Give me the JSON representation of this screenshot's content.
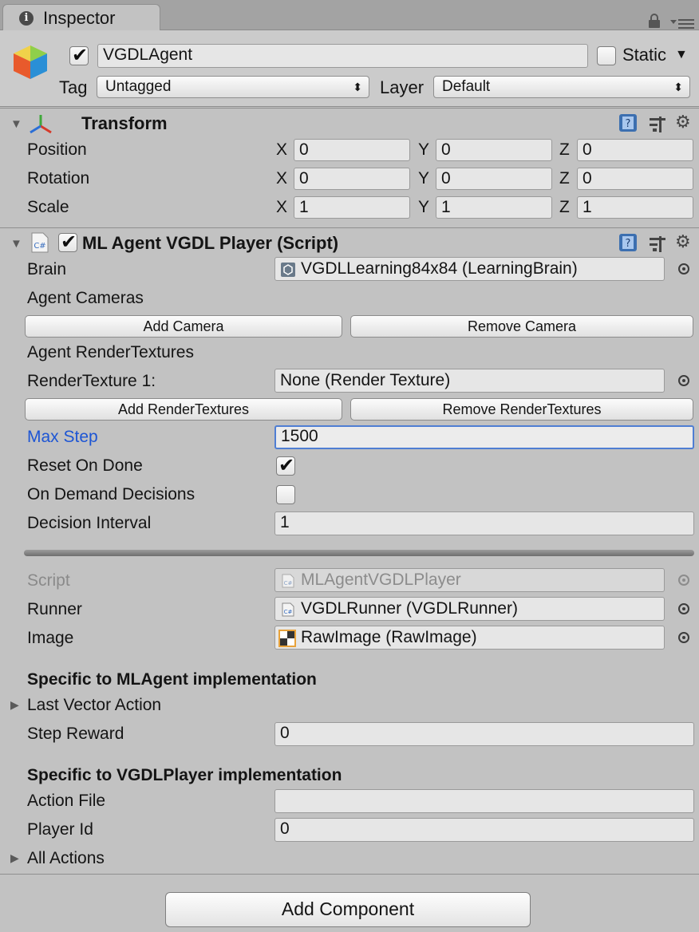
{
  "tab": {
    "title": "Inspector"
  },
  "header": {
    "object_name": "VGDLAgent",
    "static_label": "Static",
    "tag_label": "Tag",
    "tag_value": "Untagged",
    "layer_label": "Layer",
    "layer_value": "Default"
  },
  "transform": {
    "title": "Transform",
    "rows": [
      {
        "label": "Position",
        "x": "0",
        "y": "0",
        "z": "0"
      },
      {
        "label": "Rotation",
        "x": "0",
        "y": "0",
        "z": "0"
      },
      {
        "label": "Scale",
        "x": "1",
        "y": "1",
        "z": "1"
      }
    ],
    "axis": {
      "x": "X",
      "y": "Y",
      "z": "Z"
    }
  },
  "script": {
    "title": "ML Agent VGDL Player (Script)",
    "brain_label": "Brain",
    "brain_value": "VGDLLearning84x84 (LearningBrain)",
    "agent_cameras_label": "Agent Cameras",
    "add_camera": "Add Camera",
    "remove_camera": "Remove Camera",
    "agent_rendertextures_label": "Agent RenderTextures",
    "rendertexture1_label": "RenderTexture 1:",
    "rendertexture1_value": "None (Render Texture)",
    "add_rendertextures": "Add RenderTextures",
    "remove_rendertextures": "Remove RenderTextures",
    "max_step_label": "Max Step",
    "max_step_value": "1500",
    "reset_on_done_label": "Reset On Done",
    "on_demand_label": "On Demand Decisions",
    "decision_interval_label": "Decision Interval",
    "decision_interval_value": "1",
    "script_label": "Script",
    "script_value": "MLAgentVGDLPlayer",
    "runner_label": "Runner",
    "runner_value": "VGDLRunner (VGDLRunner)",
    "image_label": "Image",
    "image_value": "RawImage (RawImage)",
    "mlagent_section": "Specific to MLAgent implementation",
    "last_vector_action": "Last Vector Action",
    "step_reward_label": "Step Reward",
    "step_reward_value": "0",
    "vgdl_section": "Specific to VGDLPlayer implementation",
    "action_file_label": "Action File",
    "action_file_value": "",
    "player_id_label": "Player Id",
    "player_id_value": "0",
    "all_actions": "All Actions"
  },
  "footer": {
    "add_component": "Add Component"
  },
  "colors": {
    "accent": "#1d55d4",
    "background": "#c2c2c2",
    "focus_border": "#4f7ed3"
  }
}
